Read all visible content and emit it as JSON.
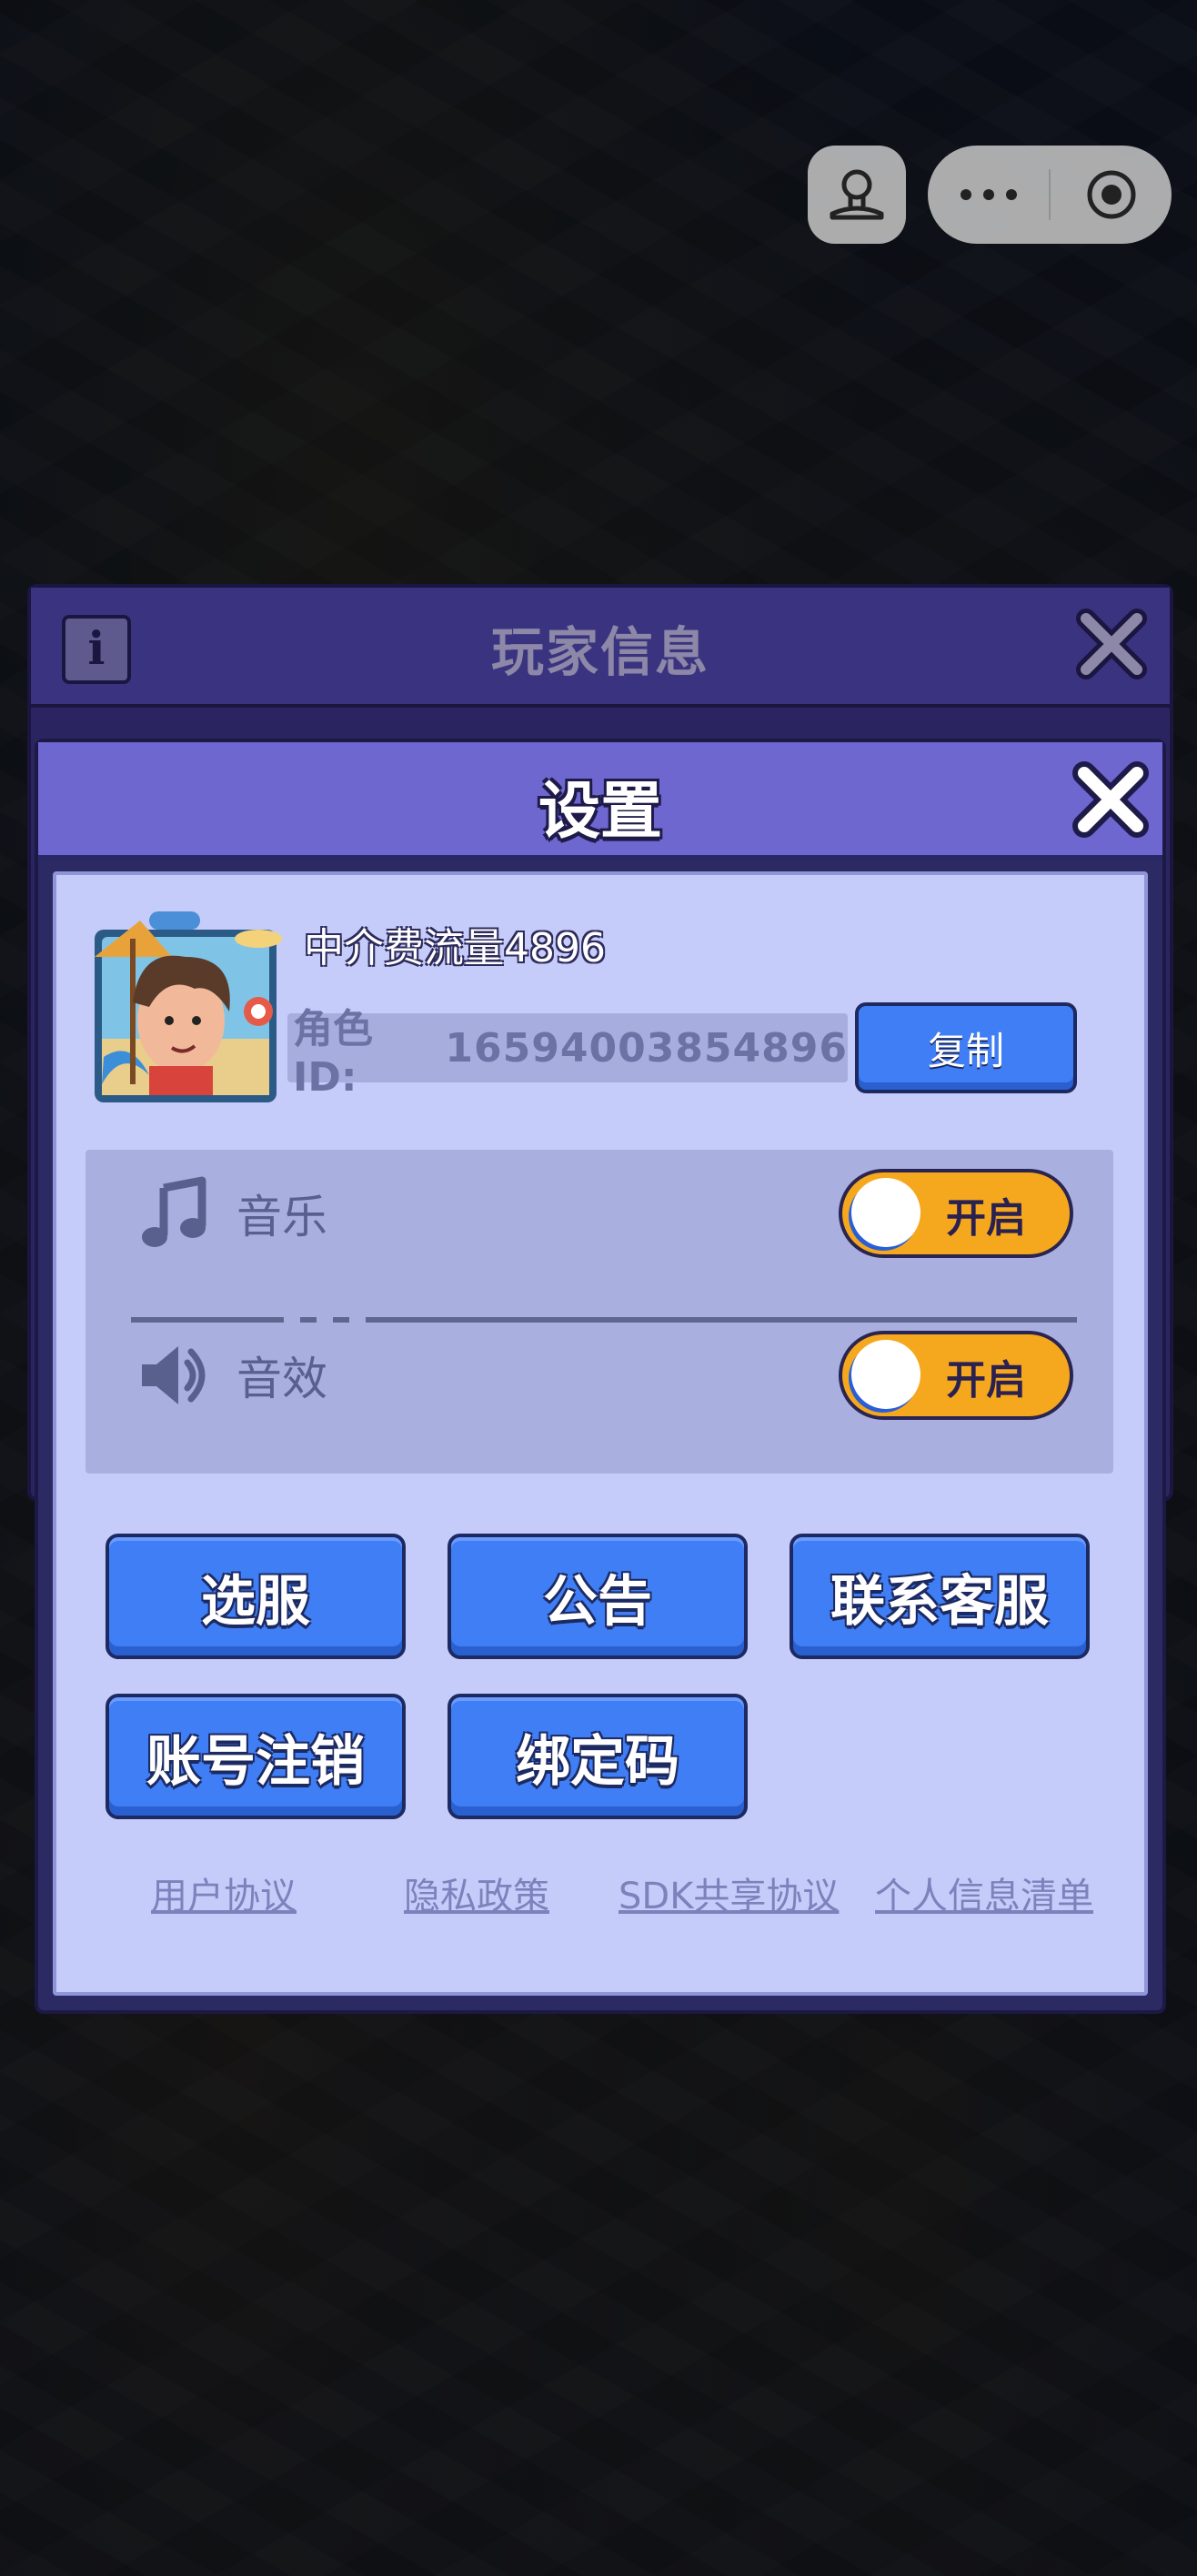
{
  "background_panel": {
    "title": "玩家信息",
    "info_icon": "info-icon"
  },
  "dialog": {
    "title": "设置",
    "profile": {
      "nickname": "中介费流量4896",
      "role_label": "角色ID:",
      "role_id": "16594003854896",
      "copy_label": "复制"
    },
    "music": {
      "label": "音乐",
      "toggle_label": "开启",
      "icon": "music-note-icon"
    },
    "sfx": {
      "label": "音效",
      "toggle_label": "开启",
      "icon": "speaker-icon"
    },
    "buttons": [
      "选服",
      "公告",
      "联系客服",
      "账号注销",
      "绑定码"
    ],
    "links": [
      "用户协议",
      "隐私政策",
      "SDK共享协议",
      "个人信息清单"
    ]
  },
  "colors": {
    "header": "#6d67cf",
    "body": "#c6ccfa",
    "button": "#3f7ef5",
    "toggle_on": "#f5a81e"
  }
}
